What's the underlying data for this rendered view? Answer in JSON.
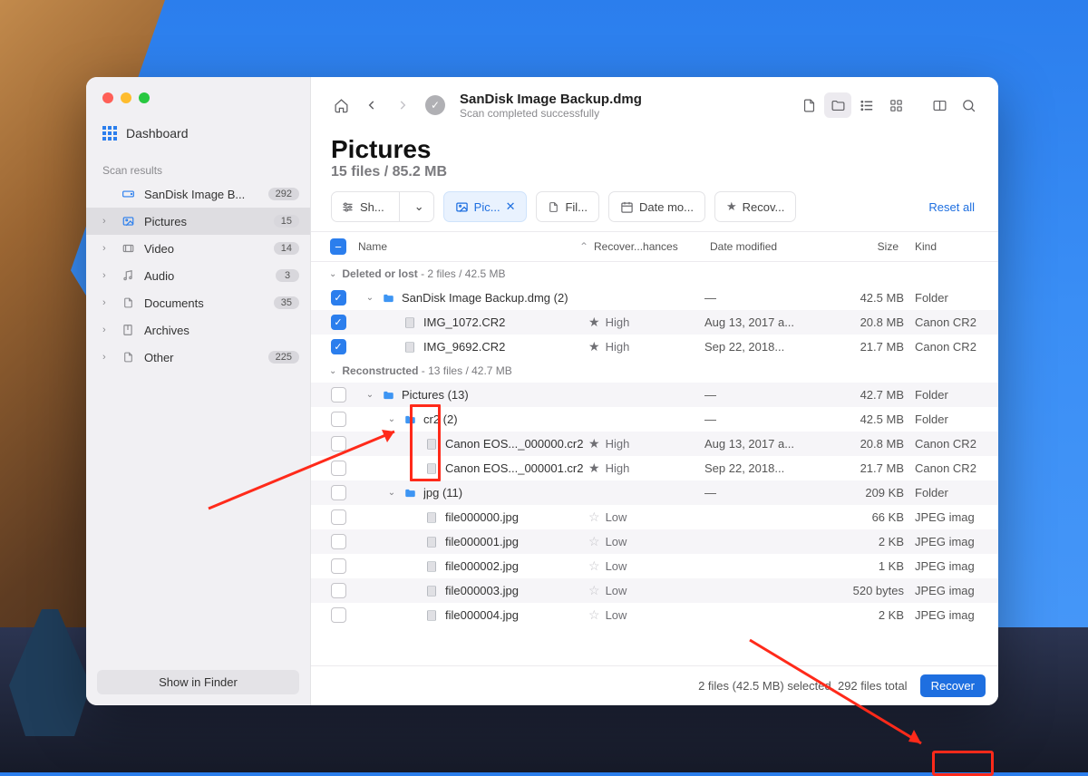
{
  "sidebar": {
    "dashboard": "Dashboard",
    "section_label": "Scan results",
    "items": [
      {
        "icon": "disk",
        "label": "SanDisk Image B...",
        "badge": "292"
      },
      {
        "icon": "image",
        "label": "Pictures",
        "badge": "15",
        "selected": true
      },
      {
        "icon": "video",
        "label": "Video",
        "badge": "14"
      },
      {
        "icon": "audio",
        "label": "Audio",
        "badge": "3"
      },
      {
        "icon": "doc",
        "label": "Documents",
        "badge": "35"
      },
      {
        "icon": "archive",
        "label": "Archives",
        "badge": ""
      },
      {
        "icon": "other",
        "label": "Other",
        "badge": "225"
      }
    ],
    "show_in_finder": "Show in Finder"
  },
  "header": {
    "title": "SanDisk Image Backup.dmg",
    "subtitle": "Scan completed successfully"
  },
  "page": {
    "title": "Pictures",
    "subtitle": "15 files / 85.2 MB"
  },
  "filters": {
    "show": "Sh...",
    "pictures": "Pic...",
    "file": "Fil...",
    "date": "Date mo...",
    "recovery": "Recov...",
    "reset": "Reset all"
  },
  "columns": {
    "name": "Name",
    "recovery": "Recover...hances",
    "date": "Date modified",
    "size": "Size",
    "kind": "Kind"
  },
  "groups": [
    {
      "title": "Deleted or lost",
      "meta": "2 files / 42.5 MB",
      "rows": [
        {
          "indent": 0,
          "checked": true,
          "chev": "down",
          "folder": true,
          "name": "SanDisk Image Backup.dmg (2)",
          "rec": "",
          "date": "—",
          "size": "42.5 MB",
          "kind": "Folder"
        },
        {
          "indent": 1,
          "checked": true,
          "folder": false,
          "name": "IMG_1072.CR2",
          "rec": "High",
          "rec_filled": true,
          "date": "Aug 13, 2017 a...",
          "size": "20.8 MB",
          "kind": "Canon CR2"
        },
        {
          "indent": 1,
          "checked": true,
          "folder": false,
          "name": "IMG_9692.CR2",
          "rec": "High",
          "rec_filled": true,
          "date": "Sep 22, 2018...",
          "size": "21.7 MB",
          "kind": "Canon CR2"
        }
      ]
    },
    {
      "title": "Reconstructed",
      "meta": "13 files / 42.7 MB",
      "rows": [
        {
          "indent": 0,
          "checked": false,
          "chev": "down",
          "folder": true,
          "name": "Pictures (13)",
          "rec": "",
          "date": "—",
          "size": "42.7 MB",
          "kind": "Folder"
        },
        {
          "indent": 1,
          "checked": false,
          "chev": "down",
          "folder": true,
          "name": "cr2 (2)",
          "rec": "",
          "date": "—",
          "size": "42.5 MB",
          "kind": "Folder"
        },
        {
          "indent": 2,
          "checked": false,
          "folder": false,
          "name": "Canon EOS..._000000.cr2",
          "rec": "High",
          "rec_filled": true,
          "date": "Aug 13, 2017 a...",
          "size": "20.8 MB",
          "kind": "Canon CR2"
        },
        {
          "indent": 2,
          "checked": false,
          "folder": false,
          "name": "Canon EOS..._000001.cr2",
          "rec": "High",
          "rec_filled": true,
          "date": "Sep 22, 2018...",
          "size": "21.7 MB",
          "kind": "Canon CR2"
        },
        {
          "indent": 1,
          "checked": false,
          "chev": "down",
          "folder": true,
          "name": "jpg (11)",
          "rec": "",
          "date": "—",
          "size": "209 KB",
          "kind": "Folder"
        },
        {
          "indent": 2,
          "checked": false,
          "folder": false,
          "name": "file000000.jpg",
          "rec": "Low",
          "rec_filled": false,
          "date": "",
          "size": "66 KB",
          "kind": "JPEG imag"
        },
        {
          "indent": 2,
          "checked": false,
          "folder": false,
          "name": "file000001.jpg",
          "rec": "Low",
          "rec_filled": false,
          "date": "",
          "size": "2 KB",
          "kind": "JPEG imag"
        },
        {
          "indent": 2,
          "checked": false,
          "folder": false,
          "name": "file000002.jpg",
          "rec": "Low",
          "rec_filled": false,
          "date": "",
          "size": "1 KB",
          "kind": "JPEG imag"
        },
        {
          "indent": 2,
          "checked": false,
          "folder": false,
          "name": "file000003.jpg",
          "rec": "Low",
          "rec_filled": false,
          "date": "",
          "size": "520 bytes",
          "kind": "JPEG imag"
        },
        {
          "indent": 2,
          "checked": false,
          "folder": false,
          "name": "file000004.jpg",
          "rec": "Low",
          "rec_filled": false,
          "date": "",
          "size": "2 KB",
          "kind": "JPEG imag"
        }
      ]
    }
  ],
  "footer": {
    "status": "2 files (42.5 MB) selected, 292 files total",
    "recover": "Recover"
  }
}
